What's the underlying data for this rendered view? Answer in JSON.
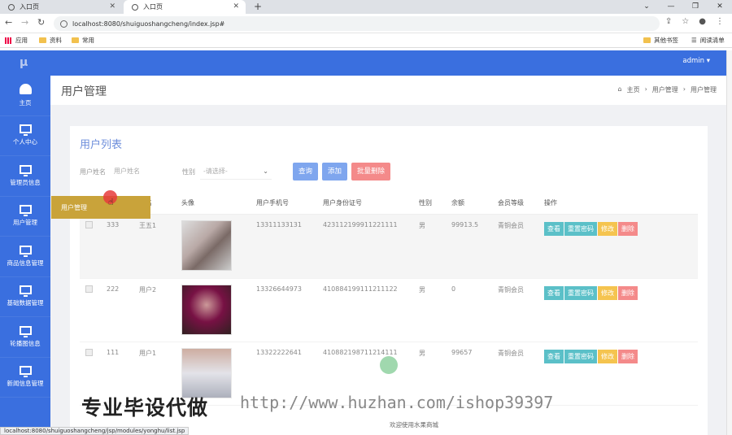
{
  "browser": {
    "tabs": [
      {
        "label": "入口页"
      },
      {
        "label": "入口页"
      }
    ],
    "url": "localhost:8080/shuiguoshangcheng/index.jsp#",
    "bookmarks": [
      {
        "label": "应用"
      },
      {
        "label": "资料"
      },
      {
        "label": "常用"
      },
      {
        "label": "其他书签"
      },
      {
        "label": "阅读清单"
      }
    ],
    "status_url": "localhost:8080/shuiguoshangcheng/jsp/modules/yonghu/list.jsp"
  },
  "header": {
    "logo": "μ",
    "user": "admin ▾"
  },
  "sidebar": {
    "items": [
      {
        "label": "主页"
      },
      {
        "label": "个人中心"
      },
      {
        "label": "管理员信息"
      },
      {
        "label": "用户管理"
      },
      {
        "label": "商品信息管理"
      },
      {
        "label": "基础数据管理"
      },
      {
        "label": "轮播图信息"
      },
      {
        "label": "新闻信息管理"
      }
    ],
    "popup": "用户管理"
  },
  "page": {
    "title": "用户管理",
    "breadcrumb": {
      "home": "主页",
      "section": "用户管理",
      "current": "用户管理"
    },
    "card_title": "用户列表"
  },
  "search": {
    "name_label": "用户姓名",
    "name_placeholder": "用户姓名",
    "gender_label": "性别",
    "gender_value": "-请选择-",
    "query": "查询",
    "add": "添加",
    "batch_delete": "批量删除"
  },
  "table": {
    "headers": [
      "",
      "",
      "姓名",
      "头像",
      "用户手机号",
      "用户身份证号",
      "性别",
      "余额",
      "会员等级",
      "操作"
    ],
    "rows": [
      {
        "id": "333",
        "name": "王五1",
        "phone": "13311133131",
        "idcard": "423112199911221111",
        "gender": "男",
        "balance": "99913.5",
        "level": "青铜会员"
      },
      {
        "id": "222",
        "name": "用户2",
        "phone": "13326644973",
        "idcard": "410884199111211122",
        "gender": "男",
        "balance": "0",
        "level": "青铜会员"
      },
      {
        "id": "111",
        "name": "用户1",
        "phone": "13322222641",
        "idcard": "410882198711214111",
        "gender": "男",
        "balance": "99657",
        "level": "青铜会员"
      }
    ],
    "ops": {
      "view": "查看",
      "reset": "重置密码",
      "edit": "修改",
      "delete": "删除"
    }
  },
  "footer": "欢迎使用水果商城",
  "watermark": {
    "cn": "专业毕设代做",
    "url": "http://www.huzhan.com/ishop39397"
  }
}
